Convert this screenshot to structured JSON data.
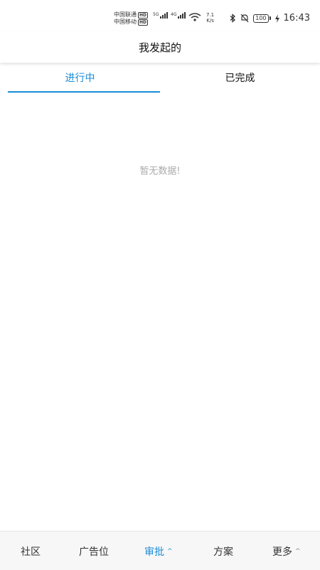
{
  "status_bar": {
    "carrier1": "中国联通",
    "carrier2": "中国移动",
    "hd_label": "HD",
    "sig1_tag": "5G",
    "sig2_tag": "4G",
    "speed_value": "7.1",
    "speed_unit": "K/s",
    "battery": "100",
    "time": "16:43"
  },
  "header": {
    "title": "我发起的"
  },
  "tabs": [
    {
      "label": "进行中",
      "active": true
    },
    {
      "label": "已完成",
      "active": false
    }
  ],
  "empty_text": "暂无数据!",
  "bottom_nav": [
    {
      "label": "社区"
    },
    {
      "label": "广告位"
    },
    {
      "label": "审批",
      "active": true,
      "caret": "^"
    },
    {
      "label": "方案"
    },
    {
      "label": "更多",
      "caret": "^"
    }
  ],
  "colors": {
    "accent": "#1a8cd8",
    "muted": "#aaaaaa"
  }
}
